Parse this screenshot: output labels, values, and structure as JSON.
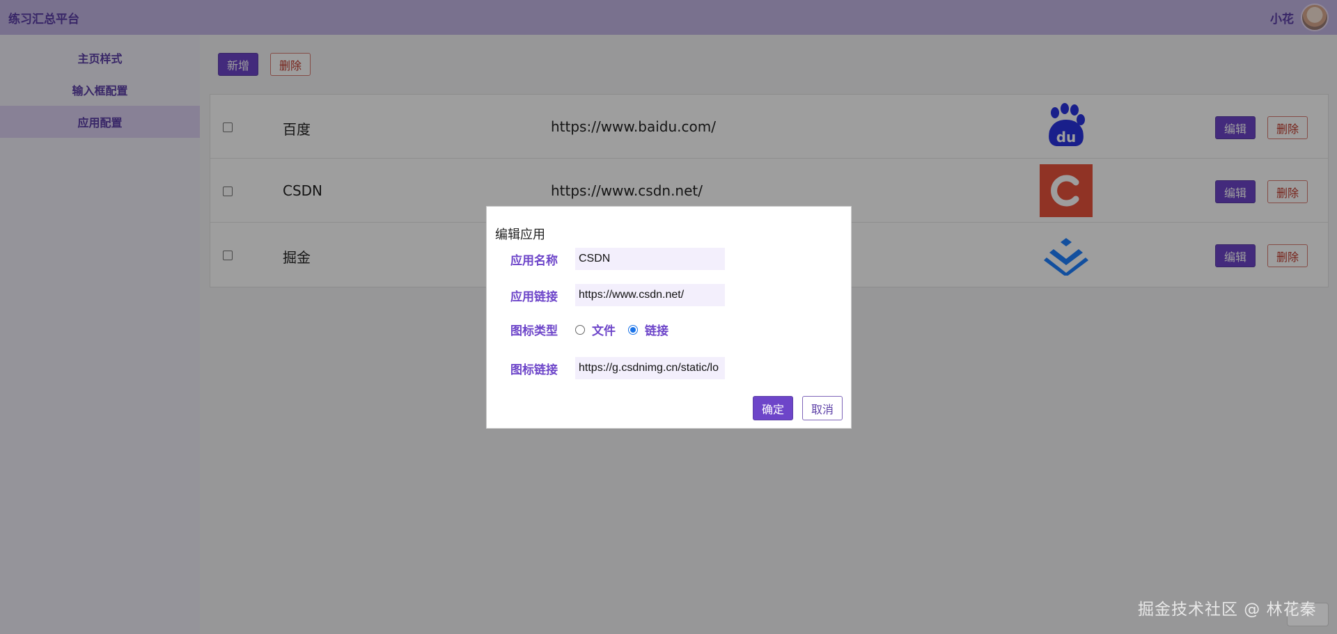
{
  "header": {
    "app_title": "练习汇总平台",
    "user_name": "小花"
  },
  "sidebar": {
    "items": [
      {
        "label": "主页样式"
      },
      {
        "label": "输入框配置"
      },
      {
        "label": "应用配置"
      }
    ]
  },
  "toolbar": {
    "add_label": "新增",
    "delete_label": "删除"
  },
  "table": {
    "rows": [
      {
        "name": "百度",
        "url": "https://www.baidu.com/",
        "logo": "baidu-logo-icon",
        "edit_label": "编辑",
        "delete_label": "删除"
      },
      {
        "name": "CSDN",
        "url": "https://www.csdn.net/",
        "logo": "csdn-logo-icon",
        "edit_label": "编辑",
        "delete_label": "删除"
      },
      {
        "name": "掘金",
        "url": "",
        "logo": "juejin-logo-icon",
        "edit_label": "编辑",
        "delete_label": "删除"
      }
    ]
  },
  "modal": {
    "title": "编辑应用",
    "fields": {
      "app_name_label": "应用名称",
      "app_name_value": "CSDN",
      "app_link_label": "应用链接",
      "app_link_value": "https://www.csdn.net/",
      "icon_type_label": "图标类型",
      "icon_type_options": [
        "文件",
        "链接"
      ],
      "icon_type_selected": "链接",
      "icon_link_label": "图标链接",
      "icon_link_value": "https://g.csdnimg.cn/static/lo"
    },
    "confirm_label": "确定",
    "cancel_label": "取消"
  },
  "watermark": "掘金技术社区 @ 林花秦",
  "colors": {
    "accent": "#6d45c9",
    "header_bg": "#c4b6e6",
    "danger": "#c0392b"
  }
}
